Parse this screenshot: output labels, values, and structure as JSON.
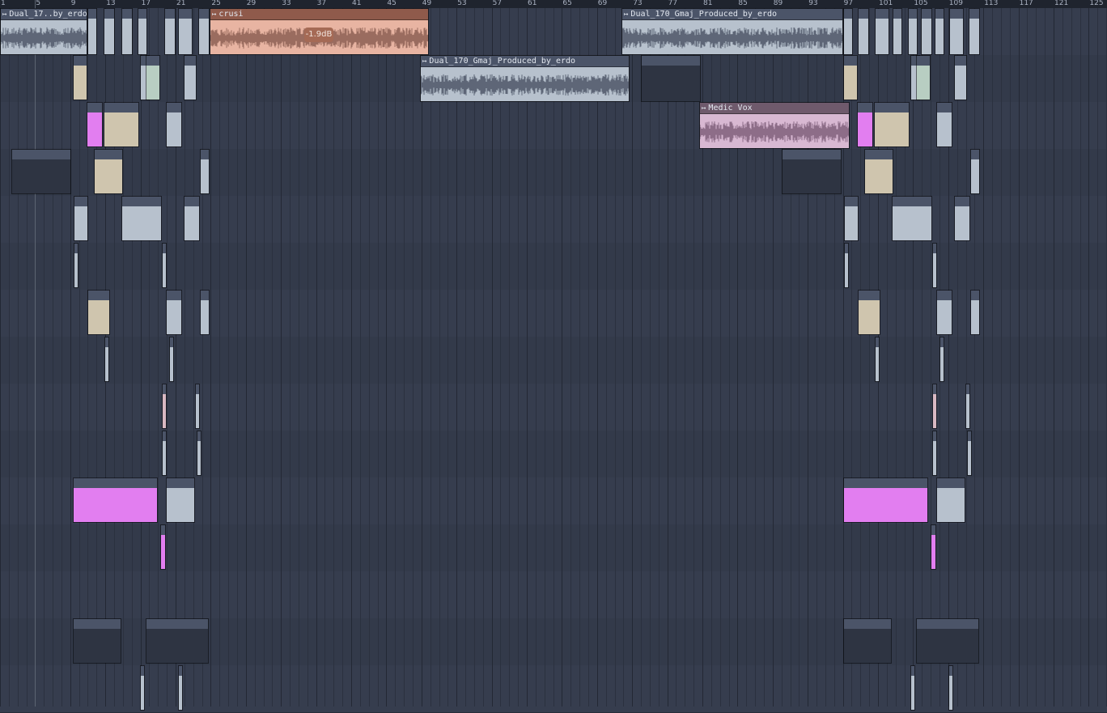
{
  "ruler": {
    "bars": [
      "1",
      "5",
      "9",
      "13",
      "17",
      "21",
      "25",
      "29",
      "33",
      "37",
      "41",
      "45",
      "49",
      "53",
      "57",
      "61",
      "65",
      "69",
      "73",
      "77",
      "81",
      "85",
      "89",
      "93",
      "97",
      "101",
      "105",
      "109",
      "113",
      "117",
      "121",
      "125"
    ]
  },
  "tracks_count": 15,
  "clips": {
    "dual17": {
      "label": "Dual_17..by_erdo",
      "icon": "clip-arrow-icon"
    },
    "crusi": {
      "label": "crusi",
      "icon": "clip-arrow-icon",
      "volume": "-1.9dB"
    },
    "dual170_top": {
      "label": "Dual_170_Gmaj_Produced_by_erdo",
      "icon": "clip-arrow-icon"
    },
    "dual170_mid": {
      "label": "Dual_170_Gmaj_Produced_by_erdo",
      "icon": "clip-arrow-icon"
    },
    "medic": {
      "label": "Medic Vox",
      "icon": "clip-arrow-icon"
    }
  },
  "colors": {
    "background": "#343b4b",
    "clip_default": "#b7c1cd",
    "clip_crusi": "#e8b4a2",
    "clip_medic": "#d8b8d2",
    "clip_magenta": "#e27ef0",
    "clip_tan": "#cfc5ae",
    "clip_green": "#b8cec2"
  }
}
